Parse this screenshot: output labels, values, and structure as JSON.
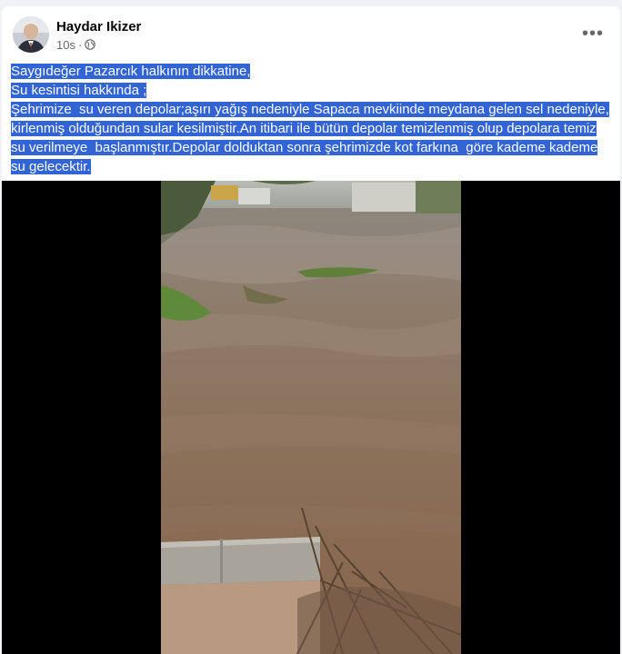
{
  "post": {
    "author": "Haydar Ikizer",
    "time": "10s",
    "visibility_icon": "globe-icon",
    "more_icon": "more-horizontal-icon",
    "more_label": "•••",
    "text_lines": [
      "Saygıdeğer Pazarcık halkının dikkatine,",
      "Su kesintisi hakkında ;",
      "Şehrimize  su veren depolar;aşırı yağış nedeniyle Sapaca mevkiinde meydana gelen sel nedeniyle,",
      "kirlenmiş olduğundan sular kesilmiştir.An itibari ile bütün depolar temizlenmiş olup depolara temiz",
      "su verilmeye  başlanmıştır.Depolar dolduktan sonra şehrimizde kot farkına  göre kademe kademe",
      "su gelecektir."
    ],
    "selection_color": "#3264d6"
  }
}
